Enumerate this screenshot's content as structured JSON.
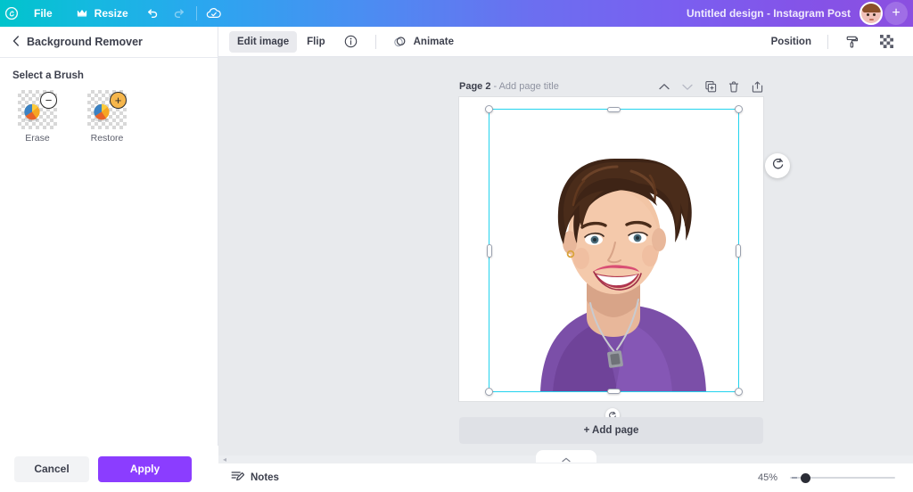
{
  "topbar": {
    "home_icon": "canva-logo-icon",
    "items": [
      {
        "label": "File",
        "icon": null
      },
      {
        "label": "Resize",
        "icon": "crown-icon"
      }
    ],
    "undo_icon": "undo-icon",
    "redo_icon": "redo-icon",
    "saved_icon": "cloud-check-icon",
    "design_title": "Untitled design - Instagram Post",
    "avatar_name": "user-avatar",
    "add_button": "+"
  },
  "left_panel": {
    "back_icon": "chevron-left-icon",
    "title": "Background Remover",
    "section_title": "Select a Brush",
    "brushes": [
      {
        "label": "Erase",
        "badge": "−",
        "icon": "erase-brush-icon"
      },
      {
        "label": "Restore",
        "badge": "+",
        "icon": "restore-brush-icon"
      }
    ],
    "cancel_label": "Cancel",
    "apply_label": "Apply",
    "apply_color": "#8b3dff"
  },
  "toolbar": {
    "edit_image_label": "Edit image",
    "flip_label": "Flip",
    "info_icon": "info-circle-icon",
    "animate_label": "Animate",
    "animate_icon": "animate-icon",
    "position_label": "Position",
    "roller_icon": "paint-roller-icon",
    "transparency_icon": "transparency-grid-icon"
  },
  "canvas": {
    "page_label": "Page 2",
    "page_title_placeholder": "- Add page title",
    "actions": [
      {
        "name": "move-page-up",
        "icon": "chevron-up-icon"
      },
      {
        "name": "move-page-down",
        "icon": "chevron-down-icon"
      },
      {
        "name": "duplicate-page",
        "icon": "duplicate-icon"
      },
      {
        "name": "delete-page",
        "icon": "trash-icon"
      },
      {
        "name": "add-page-after",
        "icon": "add-page-icon"
      }
    ],
    "rotate_icon": "rotate-icon",
    "add_page_label": "+ Add page",
    "selection_color": "#22d3ee"
  },
  "bottombar": {
    "notes_label": "Notes",
    "notes_icon": "notes-pencil-icon",
    "zoom_value": "45%",
    "collapse_icon": "chevron-up-icon"
  }
}
